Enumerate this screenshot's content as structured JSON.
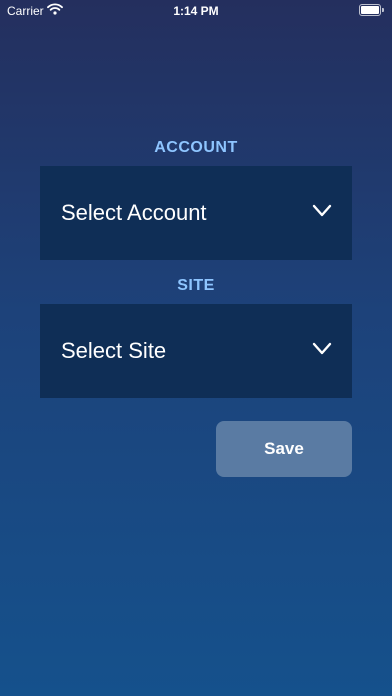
{
  "status_bar": {
    "carrier": "Carrier",
    "time": "1:14 PM"
  },
  "form": {
    "account": {
      "label": "ACCOUNT",
      "value": "Select Account",
      "icon": "chevron-down-icon"
    },
    "site": {
      "label": "SITE",
      "value": "Select Site",
      "icon": "chevron-down-icon"
    },
    "save_label": "Save"
  },
  "colors": {
    "background_top": "#242f5e",
    "background_bottom": "#15518c",
    "label_accent": "#8ec5ff",
    "dropdown_bg": "#0f2e56",
    "save_button_bg": "#5a7ba3"
  }
}
